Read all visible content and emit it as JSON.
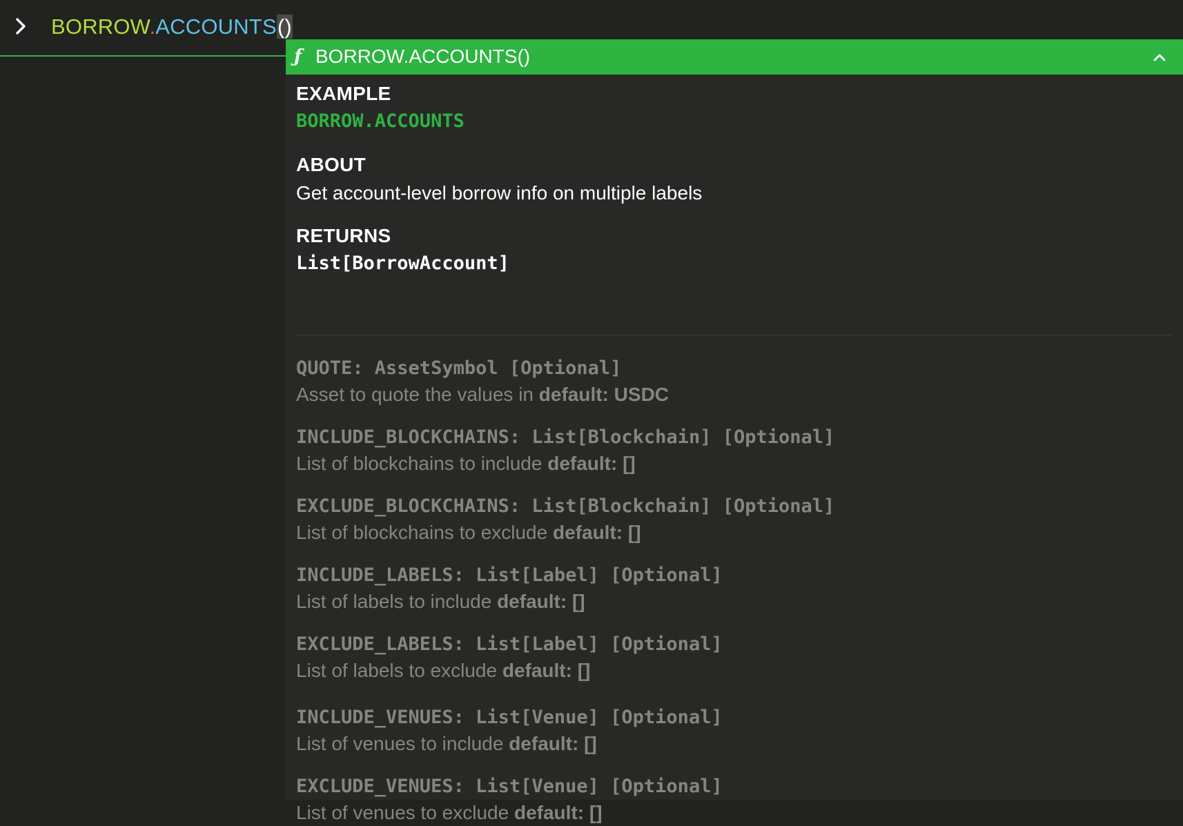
{
  "command": {
    "namespace": "BORROW",
    "dot": ".",
    "function": "ACCOUNTS",
    "parens": "()"
  },
  "popup": {
    "title": "BORROW.ACCOUNTS()",
    "header_icon": "function-icon",
    "collapse_icon": "chevron-up-icon",
    "example_heading": "EXAMPLE",
    "example_code": "BORROW.ACCOUNTS",
    "about_heading": "ABOUT",
    "about_text": "Get account-level borrow info on multiple labels",
    "returns_heading": "RETURNS",
    "returns_type": "List[BorrowAccount]",
    "default_label": "default:",
    "params": [
      {
        "signature": "QUOTE: AssetSymbol [Optional]",
        "description": "Asset to quote the values in",
        "default": "USDC"
      },
      {
        "signature": "INCLUDE_BLOCKCHAINS: List[Blockchain] [Optional]",
        "description": "List of blockchains to include",
        "default": "[]"
      },
      {
        "signature": "EXCLUDE_BLOCKCHAINS: List[Blockchain] [Optional]",
        "description": "List of blockchains to exclude",
        "default": "[]"
      },
      {
        "signature": "INCLUDE_LABELS: List[Label] [Optional]",
        "description": "List of labels to include",
        "default": "[]"
      },
      {
        "signature": "EXCLUDE_LABELS: List[Label] [Optional]",
        "description": "List of labels to exclude",
        "default": "[]"
      },
      {
        "signature": "INCLUDE_VENUES: List[Venue] [Optional]",
        "description": "List of venues to include",
        "default": "[]"
      },
      {
        "signature": "EXCLUDE_VENUES: List[Venue] [Optional]",
        "description": "List of venues to exclude",
        "default": "[]"
      }
    ]
  },
  "colors": {
    "background": "#222220",
    "popup_background": "#282826",
    "accent_green": "#2db441",
    "namespace": "#b6dc3c",
    "dot": "#ee5d52",
    "function": "#5bc4e4",
    "muted_text": "#858582"
  }
}
